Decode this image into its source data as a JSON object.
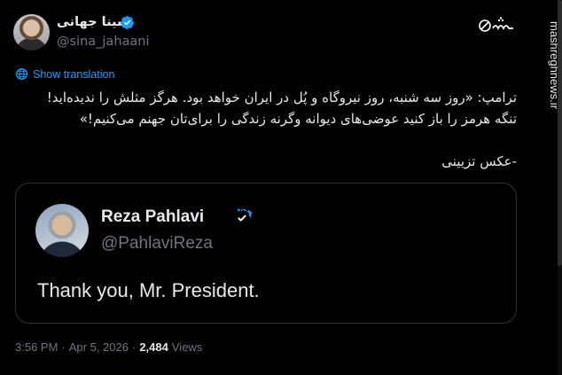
{
  "author": {
    "name": "سینا جهانی",
    "handle": "@sina_jahaani",
    "verified": true
  },
  "translate": {
    "label": "Show translation",
    "icon": "globe-icon"
  },
  "tweet": {
    "lines": [
      "ترامپ: «روز سه شنبه، روز نیروگاه و پُل در ایران خواهد بود. هرگز مثلش را ندیده‌اید!",
      "تنگه هرمز را باز کنید عوضی‌های دیوانه وگرنه زندگی را برای‌تان جهنم می‌کنیم!»",
      "-عکس تزیینی"
    ]
  },
  "quote": {
    "name": "Reza Pahlavi",
    "handle": "@PahlaviReza",
    "text": "Thank you, Mr. President.",
    "verified": true
  },
  "meta": {
    "time": "3:56 PM",
    "separator": "·",
    "date": "Apr 5, 2026",
    "views_count": "2,484",
    "views_label": "Views"
  },
  "watermark": {
    "logo_text": "مشرق",
    "site": "mashreghnews.ir"
  },
  "colors": {
    "background": "#000000",
    "text": "#e7e9ea",
    "muted": "#71767b",
    "link": "#1d9bf0",
    "border": "#2f3336"
  }
}
